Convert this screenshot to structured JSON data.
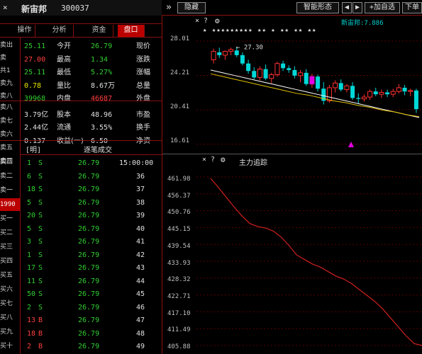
{
  "toolbar": {
    "code": "300037",
    "name": "新宙邦",
    "fold_icon": "»",
    "hide_label": "隐藏",
    "smart_label": "智能形态",
    "nav_left": "◀",
    "nav_right": "▶",
    "add_label": "+加自选",
    "menu": "≡",
    "trade": "下单",
    "close": "×"
  },
  "tabs": [
    {
      "label": "盘口",
      "active": true
    },
    {
      "label": "资金",
      "active": false
    },
    {
      "label": "分析",
      "active": false
    },
    {
      "label": "操作",
      "active": false
    }
  ],
  "side_top": [
    "卖出",
    "卖",
    "共1",
    "卖九",
    "卖八"
  ],
  "quote": [
    {
      "l1": "现价",
      "v1": "26.79",
      "l2": "今开",
      "v2": "25.11",
      "c1": "g",
      "c2": "g"
    },
    {
      "l1": "涨跌",
      "v1": "1.34",
      "l2": "最高",
      "v2": "27.00",
      "c1": "g",
      "c2": "r"
    },
    {
      "l1": "涨幅",
      "v1": "5.27%",
      "l2": "最低",
      "v2": "25.11",
      "c1": "g",
      "c2": "g"
    },
    {
      "l1": "总量",
      "v1": "8.67万",
      "l2": "量比",
      "v2": "0.78",
      "c1": "w",
      "c2": "y"
    },
    {
      "l1": "外盘",
      "v1": "46687",
      "l2": "内盘",
      "v2": "39968",
      "c1": "r",
      "c2": "g"
    },
    {
      "l1": "市盈",
      "v1": "48.96",
      "l2": "股本",
      "v2": "3.79亿",
      "c1": "w",
      "c2": "w"
    },
    {
      "l1": "换手",
      "v1": "3.55%",
      "l2": "流通",
      "v2": "2.44亿",
      "c1": "w",
      "c2": "w"
    },
    {
      "l1": "净资",
      "v1": "6.50",
      "l2": "收益(一)",
      "v2": "0.137",
      "c1": "w",
      "c2": "w"
    }
  ],
  "side_mid": [
    "卖八",
    "卖七",
    "卖六",
    "卖五",
    "卖四"
  ],
  "ticks_header": {
    "title": "逐笔成交",
    "btn": "[明]"
  },
  "ticks": [
    {
      "t": "15:00:00",
      "p": "26.79",
      "v": "1",
      "d": "S"
    },
    {
      "t": "36",
      "p": "26.79",
      "v": "6",
      "d": "S"
    },
    {
      "t": "37",
      "p": "26.79",
      "v": "18",
      "d": "S"
    },
    {
      "t": "38",
      "p": "26.79",
      "v": "5",
      "d": "S"
    },
    {
      "t": "39",
      "p": "26.79",
      "v": "20",
      "d": "S"
    },
    {
      "t": "40",
      "p": "26.79",
      "v": "5",
      "d": "S"
    },
    {
      "t": "41",
      "p": "26.79",
      "v": "3",
      "d": "S"
    },
    {
      "t": "42",
      "p": "26.79",
      "v": "1",
      "d": "S"
    },
    {
      "t": "43",
      "p": "26.79",
      "v": "17",
      "d": "S"
    },
    {
      "t": "44",
      "p": "26.79",
      "v": "11",
      "d": "S"
    },
    {
      "t": "45",
      "p": "26.79",
      "v": "50",
      "d": "S"
    },
    {
      "t": "46",
      "p": "26.79",
      "v": "2",
      "d": "S"
    },
    {
      "t": "47",
      "p": "26.79",
      "v": "13",
      "d": "B"
    },
    {
      "t": "48",
      "p": "26.79",
      "v": "18",
      "d": "B"
    },
    {
      "t": "49",
      "p": "26.79",
      "v": "2",
      "d": "B"
    }
  ],
  "side_bottom": [
    "卖三",
    "卖二",
    "卖一",
    "1990",
    "买一",
    "买二",
    "买三",
    "买四",
    "买五",
    "买六",
    "买七",
    "买八",
    "买九",
    "买十"
  ],
  "kchart": {
    "label": "新宙邦:7.886",
    "peak_label": "27.30",
    "axis": [
      "28.01",
      "24.21",
      "20.41",
      "16.61"
    ],
    "dots": "★ ★★★★★★★★★ ★★ ★ ★★ ★★ ★★",
    "help": "?",
    "close": "×",
    "gear": "⚙"
  },
  "flow": {
    "title": "主力追踪",
    "help": "?",
    "close": "×",
    "gear": "⚙",
    "axis": [
      "461.98",
      "456.37",
      "450.76",
      "445.15",
      "439.54",
      "433.93",
      "428.32",
      "422.71",
      "417.10",
      "411.49",
      "405.88"
    ]
  },
  "chart_data": [
    {
      "type": "candlestick",
      "title": "新宙邦:7.886",
      "ylim": [
        16.61,
        28.01
      ],
      "ticks": [
        "28.01",
        "24.21",
        "20.41",
        "16.61"
      ],
      "candles": [
        {
          "o": 26.0,
          "h": 27.2,
          "l": 25.6,
          "c": 26.9
        },
        {
          "o": 26.8,
          "h": 27.3,
          "l": 26.2,
          "c": 26.5
        },
        {
          "o": 26.5,
          "h": 27.0,
          "l": 26.0,
          "c": 26.9
        },
        {
          "o": 26.9,
          "h": 27.3,
          "l": 26.5,
          "c": 27.1
        },
        {
          "o": 27.0,
          "h": 27.4,
          "l": 26.3,
          "c": 26.5
        },
        {
          "o": 26.5,
          "h": 26.8,
          "l": 25.4,
          "c": 25.6
        },
        {
          "o": 25.6,
          "h": 26.0,
          "l": 24.5,
          "c": 24.8
        },
        {
          "o": 24.8,
          "h": 25.2,
          "l": 23.9,
          "c": 24.1
        },
        {
          "o": 24.1,
          "h": 25.3,
          "l": 23.8,
          "c": 25.0
        },
        {
          "o": 25.0,
          "h": 25.5,
          "l": 23.8,
          "c": 24.0
        },
        {
          "o": 24.0,
          "h": 24.6,
          "l": 23.5,
          "c": 24.4
        },
        {
          "o": 24.4,
          "h": 25.8,
          "l": 24.2,
          "c": 25.6
        },
        {
          "o": 25.6,
          "h": 25.9,
          "l": 24.8,
          "c": 25.1
        },
        {
          "o": 25.1,
          "h": 25.4,
          "l": 24.6,
          "c": 24.9
        },
        {
          "o": 24.9,
          "h": 25.3,
          "l": 24.0,
          "c": 24.3
        },
        {
          "o": 24.3,
          "h": 24.9,
          "l": 23.6,
          "c": 24.6
        },
        {
          "o": 24.6,
          "h": 25.0,
          "l": 23.2,
          "c": 23.4
        },
        {
          "o": 23.4,
          "h": 24.5,
          "l": 23.0,
          "c": 24.2
        },
        {
          "o": 24.2,
          "h": 24.4,
          "l": 22.6,
          "c": 22.9
        },
        {
          "o": 22.9,
          "h": 23.6,
          "l": 21.2,
          "c": 21.6
        },
        {
          "o": 21.6,
          "h": 23.3,
          "l": 21.4,
          "c": 23.0
        },
        {
          "o": 23.0,
          "h": 23.8,
          "l": 22.5,
          "c": 23.5
        },
        {
          "o": 23.5,
          "h": 23.9,
          "l": 22.6,
          "c": 22.8
        },
        {
          "o": 22.8,
          "h": 23.4,
          "l": 22.5,
          "c": 23.2
        },
        {
          "o": 23.2,
          "h": 23.6,
          "l": 21.7,
          "c": 21.9
        },
        {
          "o": 21.9,
          "h": 22.4,
          "l": 21.3,
          "c": 21.8
        },
        {
          "o": 21.8,
          "h": 22.3,
          "l": 21.5,
          "c": 22.0
        },
        {
          "o": 22.0,
          "h": 22.8,
          "l": 21.7,
          "c": 22.6
        },
        {
          "o": 22.6,
          "h": 23.0,
          "l": 22.1,
          "c": 22.3
        },
        {
          "o": 22.3,
          "h": 22.8,
          "l": 21.9,
          "c": 22.5
        },
        {
          "o": 22.5,
          "h": 22.8,
          "l": 22.0,
          "c": 22.3
        },
        {
          "o": 22.3,
          "h": 22.9,
          "l": 22.0,
          "c": 22.6
        },
        {
          "o": 22.6,
          "h": 23.4,
          "l": 22.4,
          "c": 23.0
        },
        {
          "o": 23.0,
          "h": 23.3,
          "l": 22.2,
          "c": 22.6
        },
        {
          "o": 22.6,
          "h": 22.9,
          "l": 22.1,
          "c": 22.7
        },
        {
          "o": 22.7,
          "h": 22.9,
          "l": 20.3,
          "c": 20.7
        }
      ],
      "ma": [
        {
          "color": "#ffffff",
          "values": [
            24.9,
            24.6,
            24.3,
            24.0,
            23.7,
            23.4,
            23.1,
            22.8,
            22.5,
            22.2,
            21.9,
            21.6,
            21.3,
            21.0,
            20.7,
            20.4,
            20.1,
            19.8
          ]
        },
        {
          "color": "#e0c000",
          "values": [
            24.5,
            24.2,
            23.9,
            23.6,
            23.3,
            23.0,
            22.7,
            22.4,
            22.2,
            21.9,
            21.6,
            21.4,
            21.1,
            20.9,
            20.6,
            20.4,
            20.1,
            19.9
          ]
        }
      ]
    },
    {
      "type": "line",
      "title": "主力追踪",
      "ylim": [
        405.88,
        461.98
      ],
      "values": [
        461.5,
        458.5,
        455.2,
        452.0,
        449.0,
        446.5,
        445.5,
        445.0,
        444.0,
        442.0,
        439.2,
        436.0,
        434.5,
        433.0,
        432.0,
        430.5,
        429.0,
        428.0,
        426.5,
        424.5,
        422.5,
        420.5,
        418.0,
        415.0,
        412.0,
        409.0,
        406.5,
        405.9
      ]
    }
  ]
}
